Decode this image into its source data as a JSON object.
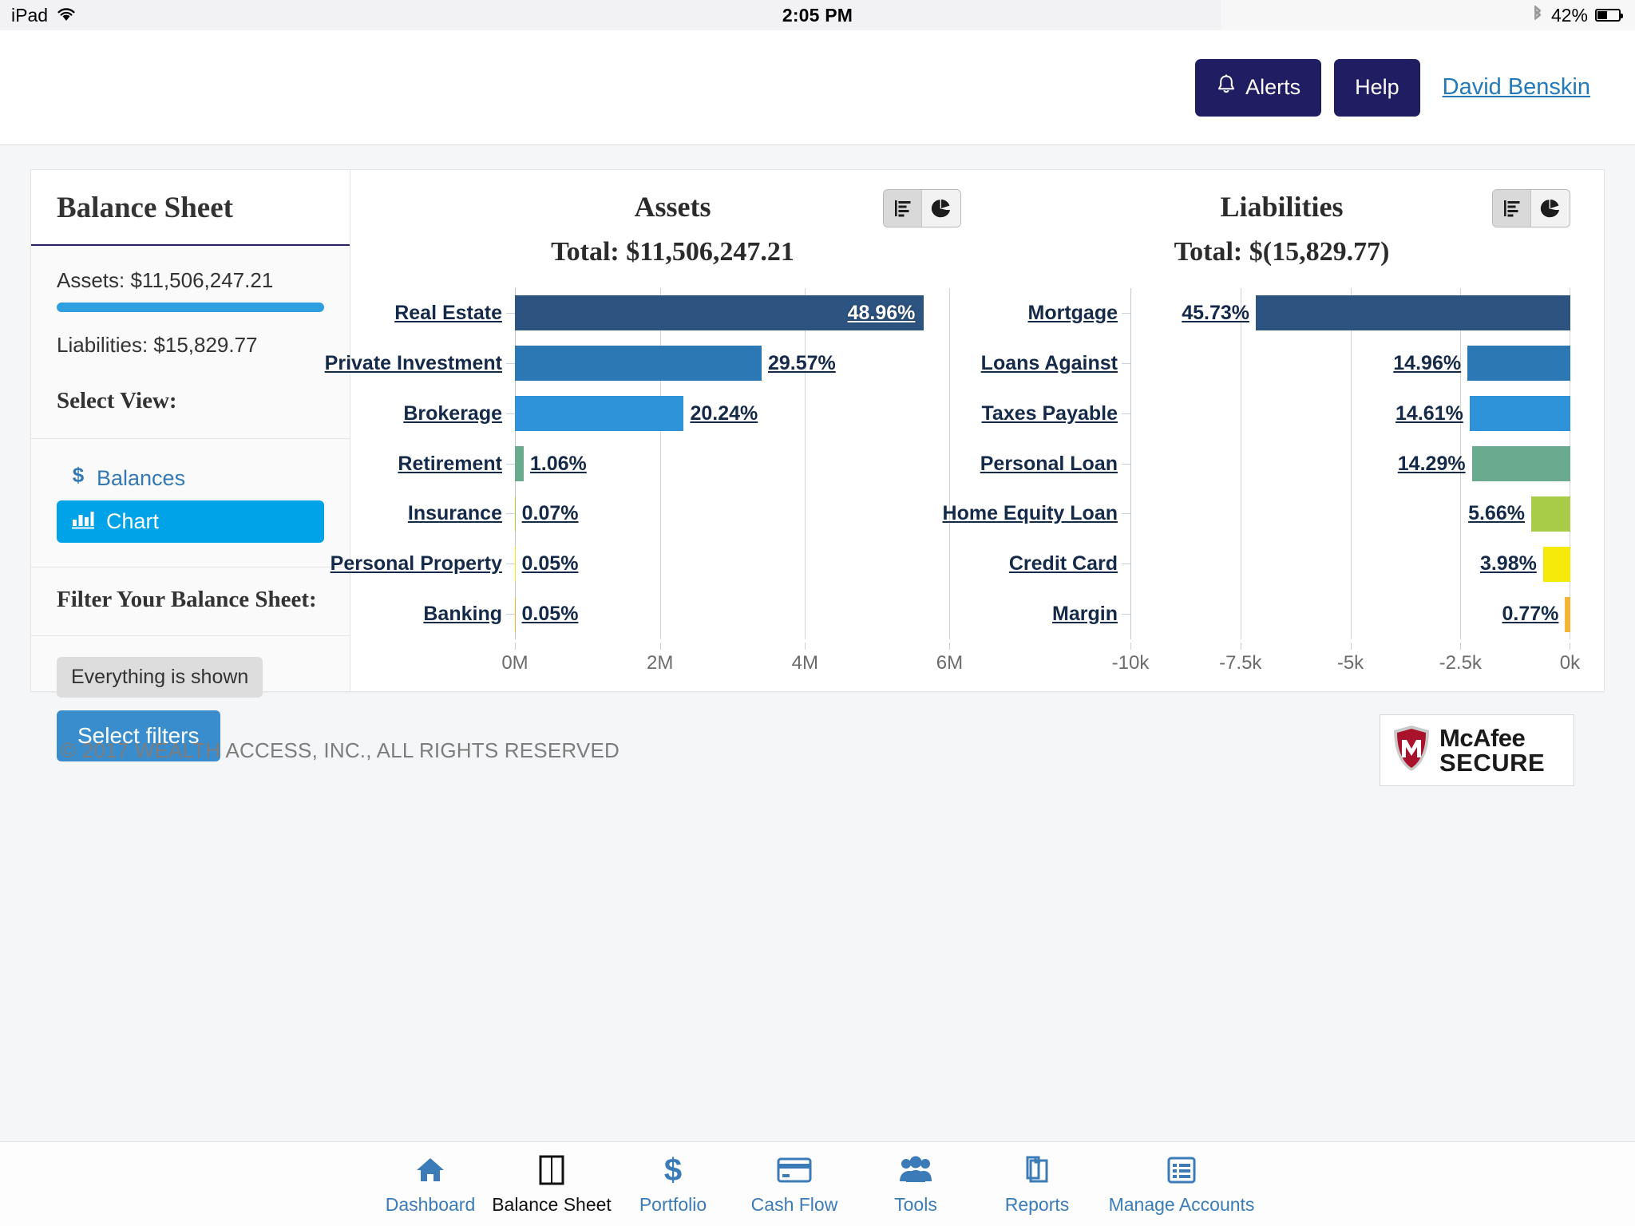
{
  "status_bar": {
    "device": "iPad",
    "wifi_icon": "wifi-icon",
    "time": "2:05 PM",
    "bluetooth_icon": "bluetooth-icon",
    "battery_percent": "42%"
  },
  "header": {
    "alerts_label": "Alerts",
    "alerts_icon": "bell-icon",
    "help_label": "Help",
    "user_name": "David Benskin ",
    "brand_color": "#201e62",
    "link_color": "#2579b9"
  },
  "sidebar": {
    "title": "Balance Sheet",
    "assets_line": "Assets: $11,506,247.21",
    "liabilities_line": "Liabilities: $15,829.77",
    "select_view_label": "Select View:",
    "views": [
      {
        "label": "Balances",
        "icon": "dollar-icon",
        "active": false
      },
      {
        "label": "Chart",
        "icon": "bar-chart-icon",
        "active": true
      }
    ],
    "filter_heading": "Filter Your Balance Sheet:",
    "filter_status": "Everything is shown",
    "select_filters_label": "Select filters",
    "meter_color": "#2e9fe0",
    "active_view_color": "#00a2e8"
  },
  "chart_data": [
    {
      "type": "bar",
      "title": "Assets",
      "subtitle": "Total: $11,506,247.21",
      "orientation": "horizontal",
      "xlabel": "",
      "ylabel": "",
      "xticks": [
        "0M",
        "2M",
        "4M",
        "6M"
      ],
      "xlim": [
        0,
        6500000
      ],
      "grid": true,
      "categories": [
        "Real Estate",
        "Private Investment",
        "Brokerage",
        "Retirement",
        "Insurance",
        "Personal Property",
        "Banking"
      ],
      "values_pct": [
        48.96,
        29.57,
        20.24,
        1.06,
        0.07,
        0.05,
        0.05
      ],
      "labels": [
        "48.96%",
        "29.57%",
        "20.24%",
        "1.06%",
        "0.07%",
        "0.05%",
        "0.05%"
      ],
      "colors": [
        "#2d5480",
        "#2b78b4",
        "#2e93d9",
        "#6aab8f",
        "#a8cc48",
        "#f5ea0a",
        "#f5b335"
      ],
      "toggle": {
        "bar_icon": "bar-chart-icon",
        "pie_icon": "pie-chart-icon",
        "selected": "bar"
      }
    },
    {
      "type": "bar",
      "title": "Liabilities",
      "subtitle": "Total: $(15,829.77)",
      "orientation": "horizontal",
      "xlabel": "",
      "ylabel": "",
      "xticks": [
        "-10k",
        "-7.5k",
        "-5k",
        "-2.5k",
        "0k"
      ],
      "xlim": [
        -10000,
        0
      ],
      "grid": true,
      "categories": [
        "Mortgage",
        "Loans Against",
        "Taxes Payable",
        "Personal Loan",
        "Home Equity Loan",
        "Credit Card",
        "Margin"
      ],
      "values_pct": [
        45.73,
        14.96,
        14.61,
        14.29,
        5.66,
        3.98,
        0.77
      ],
      "labels": [
        "45.73%",
        "14.96%",
        "14.61%",
        "14.29%",
        "5.66%",
        "3.98%",
        "0.77%"
      ],
      "colors": [
        "#2d5480",
        "#2b78b4",
        "#2e93d9",
        "#6aab8f",
        "#a8cc48",
        "#f5ea0a",
        "#f5b335"
      ],
      "toggle": {
        "bar_icon": "bar-chart-icon",
        "pie_icon": "pie-chart-icon",
        "selected": "bar"
      }
    }
  ],
  "footer": {
    "copyright": "© 2017 WEALTH ACCESS, INC., ALL RIGHTS RESERVED",
    "badge_line1": "McAfee",
    "badge_line2": "SECURE"
  },
  "tabbar": {
    "items": [
      {
        "label": "Dashboard",
        "icon": "home-icon",
        "active": false
      },
      {
        "label": "Balance Sheet",
        "icon": "balance-sheet-icon",
        "active": true
      },
      {
        "label": "Portfolio",
        "icon": "dollar-icon",
        "active": false
      },
      {
        "label": "Cash Flow",
        "icon": "credit-card-icon",
        "active": false
      },
      {
        "label": "Tools",
        "icon": "people-icon",
        "active": false
      },
      {
        "label": "Reports",
        "icon": "documents-icon",
        "active": false
      },
      {
        "label": "Manage Accounts",
        "icon": "list-icon",
        "active": false
      }
    ]
  }
}
